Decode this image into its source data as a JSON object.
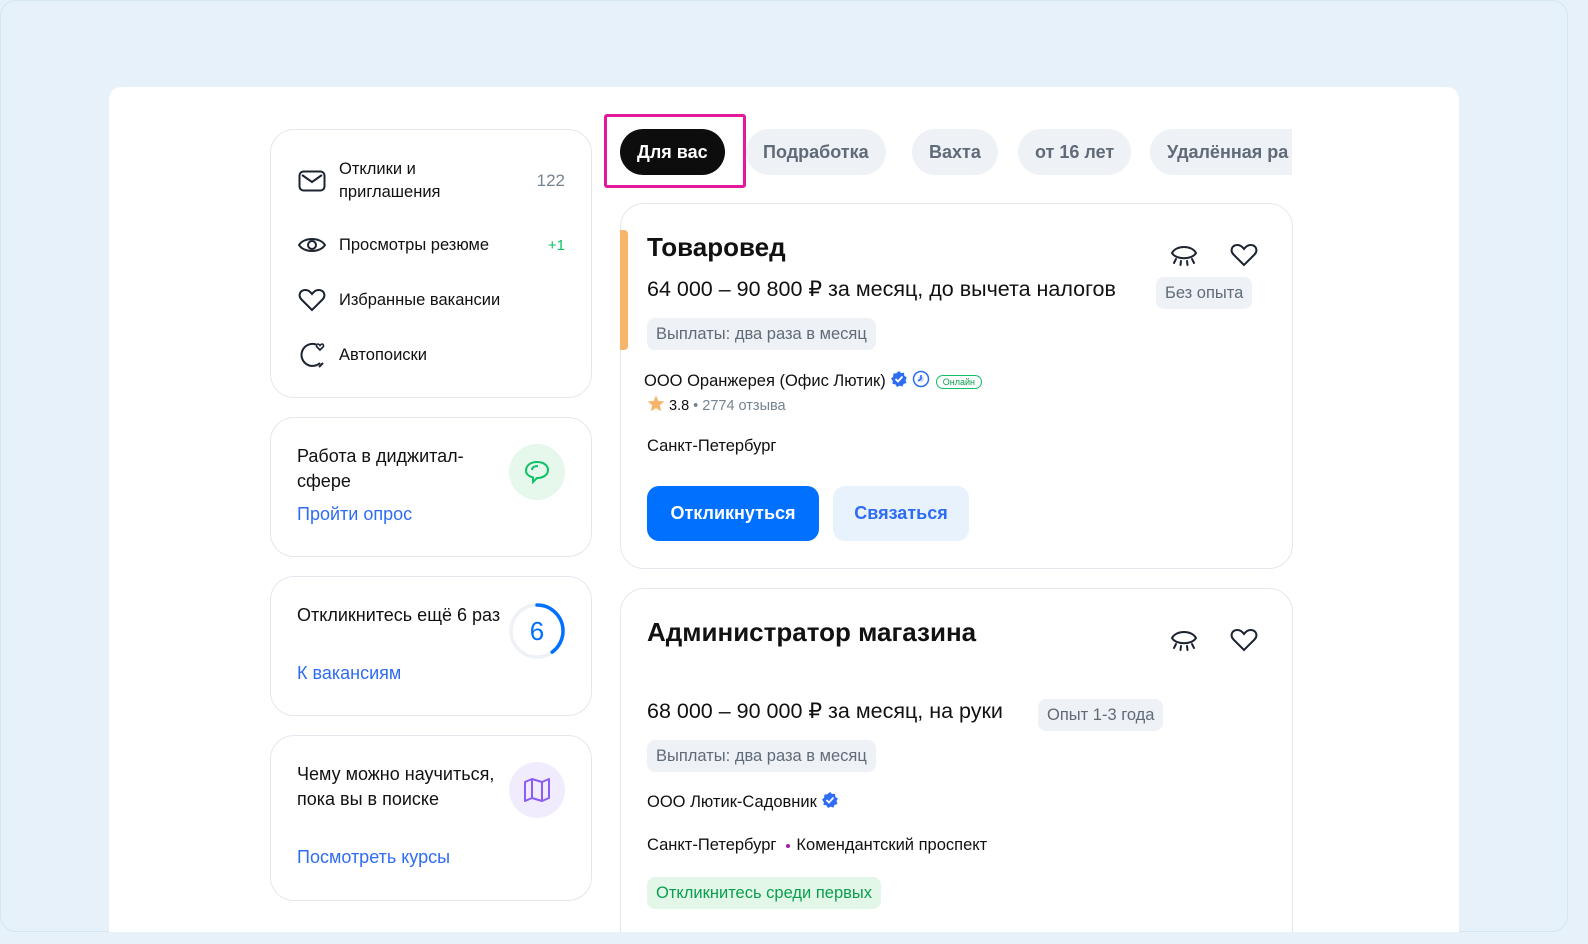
{
  "sidebar": {
    "menu": [
      {
        "label": "Отклики и приглашения",
        "count": "122",
        "icon": "envelope-icon"
      },
      {
        "label": "Просмотры резюме",
        "count": "+1",
        "icon": "eye-icon"
      },
      {
        "label": "Избранные вакансии",
        "count": "",
        "icon": "heart-icon"
      },
      {
        "label": "Автопоиски",
        "count": "",
        "icon": "autosearch-icon"
      }
    ],
    "promo_digital": {
      "title": "Работа в диджитал-сфере",
      "link": "Пройти опрос",
      "icon": "chat-bubbles-icon",
      "color": "#0dc267"
    },
    "promo_respond": {
      "title": "Откликнитесь ещё 6 раз",
      "link": "К вакансиям",
      "counter": "6",
      "progress": 0.4,
      "color": "#0070ff"
    },
    "promo_courses": {
      "title": "Чему можно научиться, пока вы в поиске",
      "link": "Посмотреть курсы",
      "icon": "map-icon",
      "color": "#8b5cf6"
    }
  },
  "chips": [
    "Для вас",
    "Подработка",
    "Вахта",
    "от 16 лет",
    "Удалённая ра"
  ],
  "active_chip": "Для вас",
  "vacancies": [
    {
      "title": "Товаровед",
      "salary": "64 000 – 90 800 ₽ за месяц, до вычета налогов",
      "experience": "Без опыта",
      "payments": "Выплаты: два раза в месяц",
      "company": "ООО Оранжерея (Офис Лютик)",
      "online": "Онлайн",
      "rating": "3.8",
      "reviews": "2774 отзыва",
      "city": "Санкт-Петербург",
      "respond": "Откликнуться",
      "contact": "Связаться"
    },
    {
      "title": "Администратор магазина",
      "salary": "68 000 – 90 000 ₽ за месяц, на руки",
      "experience": "Опыт 1-3 года",
      "payments": "Выплаты: два раза в месяц",
      "company": "ООО Лютик-Садовник",
      "city": "Санкт-Петербург",
      "metro": "Комендантский проспект",
      "badge": "Откликнитесь среди первых"
    }
  ],
  "colors": {
    "accent": "#0070ff",
    "highlight": "#e4189b",
    "vacancy_accent": "#f7b56c"
  }
}
